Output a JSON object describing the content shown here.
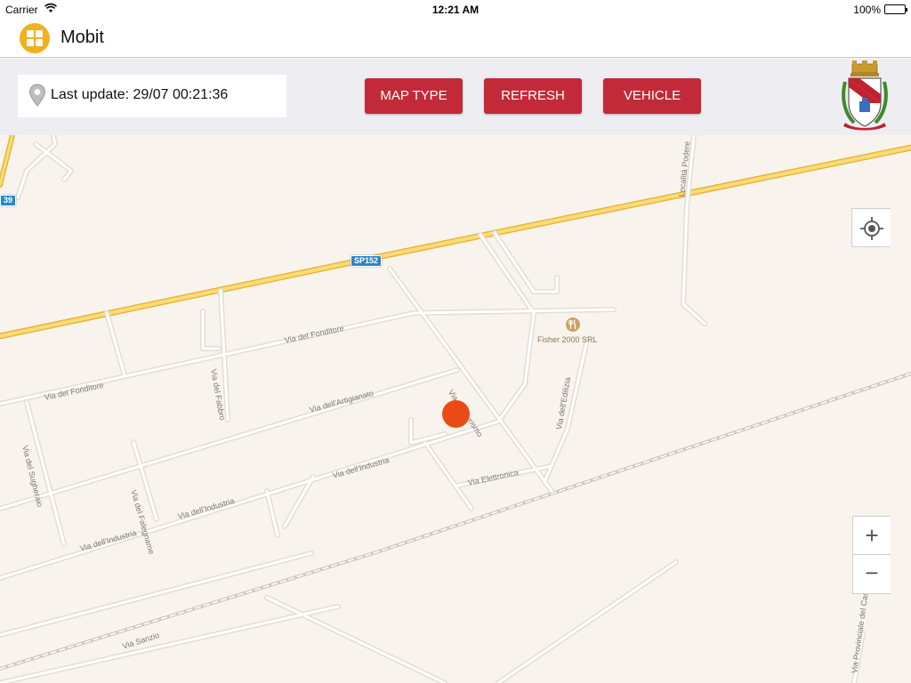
{
  "status_bar": {
    "carrier": "Carrier",
    "wifi_icon": "wifi-icon",
    "time": "12:21 AM",
    "battery": "100%",
    "battery_icon": "battery-icon"
  },
  "nav": {
    "app_icon": "grid-menu-icon",
    "title": "Mobit"
  },
  "toolbar": {
    "pin_icon": "location-pin-icon",
    "last_update_label": "Last update: 29/07 00:21:36",
    "map_type_button": "MAP TYPE",
    "refresh_button": "REFRESH",
    "vehicle_button": "VEHICLE",
    "crest_icon": "municipal-crest-icon"
  },
  "map": {
    "route_badges": [
      "SP152",
      "39"
    ],
    "streets": [
      "Via del Fonditore",
      "Via del Fonditore",
      "Via del Fabbro",
      "Via dell'Artigianato",
      "Via del Sugheraio",
      "Via del Falegname",
      "Via dell'Industria",
      "Via dell'Industria",
      "Via dell'Industria",
      "Via del Turismo",
      "Via Elettronica",
      "Via dell'Edilizia",
      "Località Podere",
      "Via Sanzio",
      "Via Provinciale del Casone"
    ],
    "poi": {
      "name": "Fisher 2000 SRL",
      "icon": "restaurant-icon"
    },
    "vehicle_marker_color": "#ea4b16",
    "controls": {
      "locate_icon": "locate-me-icon",
      "zoom_in": "+",
      "zoom_out": "−"
    }
  },
  "colors": {
    "accent_button": "#c32a39",
    "app_icon": "#f0b21c",
    "map_background": "#f8f3ec",
    "highway": "#f5c84c"
  }
}
